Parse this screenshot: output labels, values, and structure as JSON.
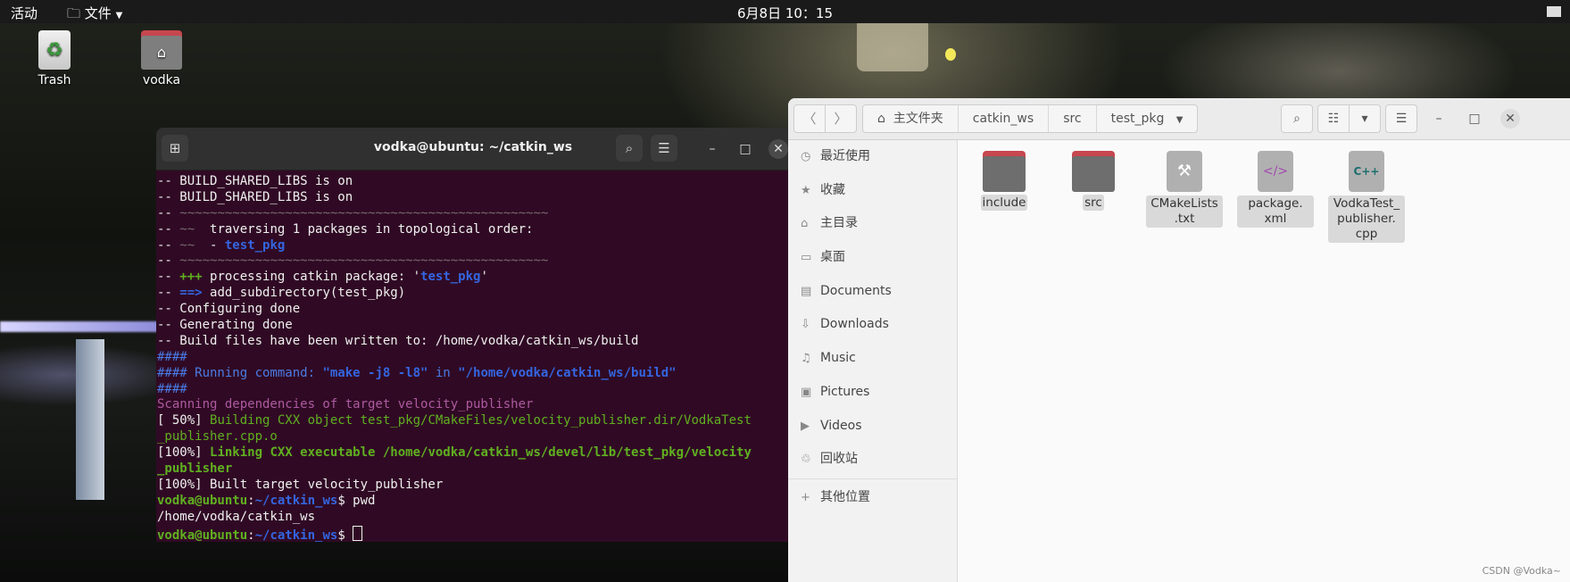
{
  "topbar": {
    "activities": "活动",
    "files_menu": "文件",
    "clock": "6月8日 10：15"
  },
  "desktop": {
    "trash_label": "Trash",
    "home_label": "vodka",
    "trash_glyph": "♻",
    "home_glyph": "⌂"
  },
  "terminal": {
    "title": "vodka@ubuntu: ~/catkin_ws",
    "lines": [
      [
        [
          "-- BUILD_SHARED_LIBS is on",
          ""
        ]
      ],
      [
        [
          "-- BUILD_SHARED_LIBS is on",
          ""
        ]
      ],
      [
        [
          "-- ",
          ""
        ],
        [
          "~~~~~~~~~~~~~~~~~~~~~~~~~~~~~~~~~~~~~~~~~~~~~~~~~",
          "gray"
        ]
      ],
      [
        [
          "-- ",
          ""
        ],
        [
          "~~",
          "gray"
        ],
        [
          "  traversing 1 packages in topological order:",
          ""
        ]
      ],
      [
        [
          "-- ",
          ""
        ],
        [
          "~~",
          "gray"
        ],
        [
          "  - ",
          ""
        ],
        [
          "test_pkg",
          "blue"
        ]
      ],
      [
        [
          "-- ",
          ""
        ],
        [
          "~~~~~~~~~~~~~~~~~~~~~~~~~~~~~~~~~~~~~~~~~~~~~~~~~",
          "gray"
        ]
      ],
      [
        [
          "-- ",
          ""
        ],
        [
          "+++",
          "green"
        ],
        [
          " processing catkin package: '",
          ""
        ],
        [
          "test_pkg",
          "blue"
        ],
        [
          "'",
          ""
        ]
      ],
      [
        [
          "-- ",
          ""
        ],
        [
          "==>",
          "blue"
        ],
        [
          " add_subdirectory(test_pkg)",
          ""
        ]
      ],
      [
        [
          "-- Configuring done",
          ""
        ]
      ],
      [
        [
          "-- Generating done",
          ""
        ]
      ],
      [
        [
          "-- Build files have been written to: /home/vodka/catkin_ws/build",
          ""
        ]
      ],
      [
        [
          "####",
          "bluen"
        ]
      ],
      [
        [
          "#### Running command: ",
          "bluen"
        ],
        [
          "\"make -j8 -l8\"",
          "blue"
        ],
        [
          " in ",
          "bluen"
        ],
        [
          "\"/home/vodka/catkin_ws/build\"",
          "blue"
        ]
      ],
      [
        [
          "####",
          "bluen"
        ]
      ],
      [
        [
          "Scanning dependencies of target velocity_publisher",
          "magenta"
        ]
      ],
      [
        [
          "[ 50%] ",
          ""
        ],
        [
          "Building CXX object test_pkg/CMakeFiles/velocity_publisher.dir/VodkaTest",
          "greenn"
        ]
      ],
      [
        [
          "_publisher.cpp.o",
          "greenn"
        ]
      ],
      [
        [
          "[100%] ",
          ""
        ],
        [
          "Linking CXX executable /home/vodka/catkin_ws/devel/lib/test_pkg/velocity",
          "green"
        ]
      ],
      [
        [
          "_publisher",
          "green"
        ]
      ],
      [
        [
          "[100%] Built target velocity_publisher",
          ""
        ]
      ],
      [
        [
          "vodka@ubuntu",
          "green"
        ],
        [
          ":",
          ""
        ],
        [
          "~/catkin_ws",
          "blue"
        ],
        [
          "$ pwd",
          ""
        ]
      ],
      [
        [
          "/home/vodka/catkin_ws",
          ""
        ]
      ],
      [
        [
          "vodka@ubuntu",
          "green"
        ],
        [
          ":",
          ""
        ],
        [
          "~/catkin_ws",
          "blue"
        ],
        [
          "$ ",
          ""
        ]
      ]
    ]
  },
  "files": {
    "path": [
      "主文件夹",
      "catkin_ws",
      "src",
      "test_pkg"
    ],
    "sidebar": [
      {
        "label": "最近使用",
        "icon": "◷"
      },
      {
        "label": "收藏",
        "icon": "★"
      },
      {
        "label": "主目录",
        "icon": "⌂"
      },
      {
        "label": "桌面",
        "icon": "▭"
      },
      {
        "label": "Documents",
        "icon": "▤"
      },
      {
        "label": "Downloads",
        "icon": "⇩"
      },
      {
        "label": "Music",
        "icon": "♫"
      },
      {
        "label": "Pictures",
        "icon": "▣"
      },
      {
        "label": "Videos",
        "icon": "▶"
      },
      {
        "label": "回收站",
        "icon": "♲"
      },
      {
        "label": "其他位置",
        "icon": "+"
      }
    ],
    "items": [
      {
        "name": "include",
        "type": "folder"
      },
      {
        "name": "src",
        "type": "folder"
      },
      {
        "name": "CMakeLists\n.txt",
        "type": "cmake",
        "glyph": "⚒"
      },
      {
        "name": "package.\nxml",
        "type": "xml",
        "glyph": "</>"
      },
      {
        "name": "VodkaTest_\npublisher.\ncpp",
        "type": "cpp",
        "glyph": "C++"
      }
    ]
  },
  "watermark": "CSDN @Vodka~"
}
